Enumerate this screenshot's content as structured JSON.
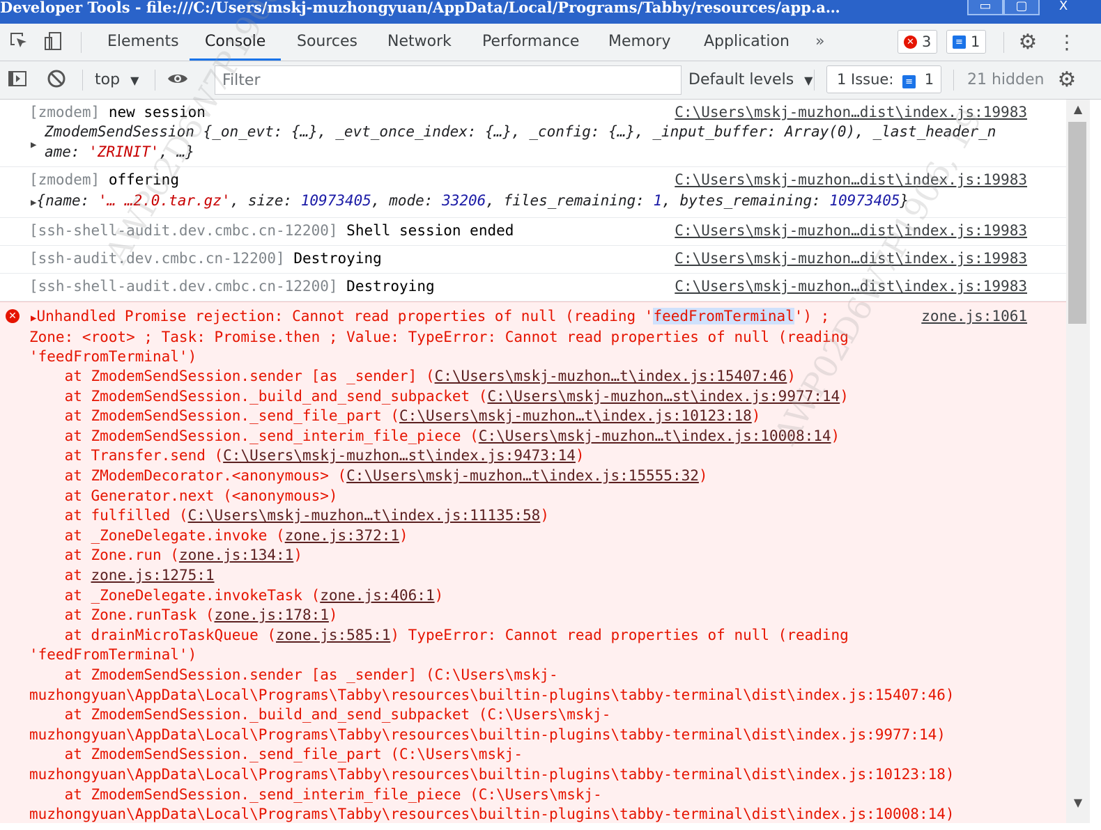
{
  "window": {
    "title": "Developer Tools - file:///C:/Users/mskj-muzhongyuan/AppData/Local/Programs/Tabby/resources/app.a…",
    "minimize_icon": "minimize-icon",
    "maximize_icon": "maximize-icon",
    "close_icon": "close-icon"
  },
  "tabbar": {
    "tabs": [
      "Elements",
      "Console",
      "Sources",
      "Network",
      "Performance",
      "Memory",
      "Application"
    ],
    "active_tab": "Console",
    "more_tabs": "»",
    "errors_count": "3",
    "messages_count": "1"
  },
  "consolebar": {
    "context": "top",
    "filter_placeholder": "Filter",
    "levels": "Default levels",
    "issues_label": "1 Issue:",
    "issues_count": "1",
    "hidden": "21 hidden"
  },
  "messages": [
    {
      "prefix": "[zmodem]",
      "text": "new session",
      "source": "C:\\Users\\mskj-muzhon…dist\\index.js:19983",
      "object_line1": "ZmodemSendSession {_on_evt: {…}, _evt_once_index: {…}, _config: {…}, _input_buffer: Array(0), _last_header_n",
      "object_line2_a": "ame: ",
      "object_line2_str": "'ZRINIT'",
      "object_line2_b": ", …}"
    },
    {
      "prefix": "[zmodem]",
      "text": "offering",
      "source": "C:\\Users\\mskj-muzhon…dist\\index.js:19983",
      "o_name_key": "{name: ",
      "o_name_val": "'… …2.0.tar.gz'",
      "o_size_key": ", size: ",
      "o_size_val": "10973405",
      "o_mode_key": ", mode: ",
      "o_mode_val": "33206",
      "o_fr_key": ", files_remaining: ",
      "o_fr_val": "1",
      "o_br_key": ", bytes_remaining: ",
      "o_br_val": "10973405",
      "o_end": "}"
    },
    {
      "prefix": "[ssh-shell-audit.dev.cmbc.cn-12200]",
      "text": "Shell session ended",
      "source": "C:\\Users\\mskj-muzhon…dist\\index.js:19983"
    },
    {
      "prefix": "[ssh-audit.dev.cmbc.cn-12200]",
      "text": "Destroying",
      "source": "C:\\Users\\mskj-muzhon…dist\\index.js:19983"
    },
    {
      "prefix": "[ssh-shell-audit.dev.cmbc.cn-12200]",
      "text": "Destroying",
      "source": "C:\\Users\\mskj-muzhon…dist\\index.js:19983"
    }
  ],
  "error": {
    "source": "zone.js:1061",
    "head_a": "Unhandled Promise rejection: Cannot read properties of null (reading '",
    "head_hl": "feedFromTerminal",
    "head_b": "') ;",
    "line2": "Zone: <root> ; Task: Promise.then ; Value: TypeError: Cannot read properties of null (reading",
    "line3": "'feedFromTerminal')",
    "stack": [
      {
        "fn": "    at ZmodemSendSession.sender [as _sender] (",
        "link": "C:\\Users\\mskj-muzhon…t\\index.js:15407:46",
        "end": ")"
      },
      {
        "fn": "    at ZmodemSendSession._build_and_send_subpacket (",
        "link": "C:\\Users\\mskj-muzhon…st\\index.js:9977:14",
        "end": ")"
      },
      {
        "fn": "    at ZmodemSendSession._send_file_part (",
        "link": "C:\\Users\\mskj-muzhon…t\\index.js:10123:18",
        "end": ")"
      },
      {
        "fn": "    at ZmodemSendSession._send_interim_file_piece (",
        "link": "C:\\Users\\mskj-muzhon…t\\index.js:10008:14",
        "end": ")"
      },
      {
        "fn": "    at Transfer.send (",
        "link": "C:\\Users\\mskj-muzhon…st\\index.js:9473:14",
        "end": ")"
      },
      {
        "fn": "    at ZModemDecorator.<anonymous> (",
        "link": "C:\\Users\\mskj-muzhon…t\\index.js:15555:32",
        "end": ")"
      },
      {
        "fn": "    at Generator.next (<anonymous>)",
        "link": "",
        "end": ""
      },
      {
        "fn": "    at fulfilled (",
        "link": "C:\\Users\\mskj-muzhon…t\\index.js:11135:58",
        "end": ")"
      },
      {
        "fn": "    at _ZoneDelegate.invoke (",
        "link": "zone.js:372:1",
        "end": ")"
      },
      {
        "fn": "    at Zone.run (",
        "link": "zone.js:134:1",
        "end": ")"
      },
      {
        "fn": "    at ",
        "link": "zone.js:1275:1",
        "end": ""
      },
      {
        "fn": "    at _ZoneDelegate.invokeTask (",
        "link": "zone.js:406:1",
        "end": ")"
      },
      {
        "fn": "    at Zone.runTask (",
        "link": "zone.js:178:1",
        "end": ")"
      },
      {
        "fn": "    at drainMicroTaskQueue (",
        "link": "zone.js:585:1",
        "end": ") TypeError: Cannot read properties of null (reading"
      }
    ],
    "tail": [
      "'feedFromTerminal')",
      "    at ZmodemSendSession.sender [as _sender] (C:\\Users\\mskj-",
      "muzhongyuan\\AppData\\Local\\Programs\\Tabby\\resources\\builtin-plugins\\tabby-terminal\\dist\\index.js:15407:46)",
      "    at ZmodemSendSession._build_and_send_subpacket (C:\\Users\\mskj-",
      "muzhongyuan\\AppData\\Local\\Programs\\Tabby\\resources\\builtin-plugins\\tabby-terminal\\dist\\index.js:9977:14)",
      "    at ZmodemSendSession._send_file_part (C:\\Users\\mskj-",
      "muzhongyuan\\AppData\\Local\\Programs\\Tabby\\resources\\builtin-plugins\\tabby-terminal\\dist\\index.js:10123:18)",
      "    at ZmodemSendSession._send_interim_file_piece (C:\\Users\\mskj-",
      "muzhongyuan\\AppData\\Local\\Programs\\Tabby\\resources\\builtin-plugins\\tabby-terminal\\dist\\index.js:10008:14)"
    ]
  },
  "watermark": "AWP02D6W7P1906, 19"
}
